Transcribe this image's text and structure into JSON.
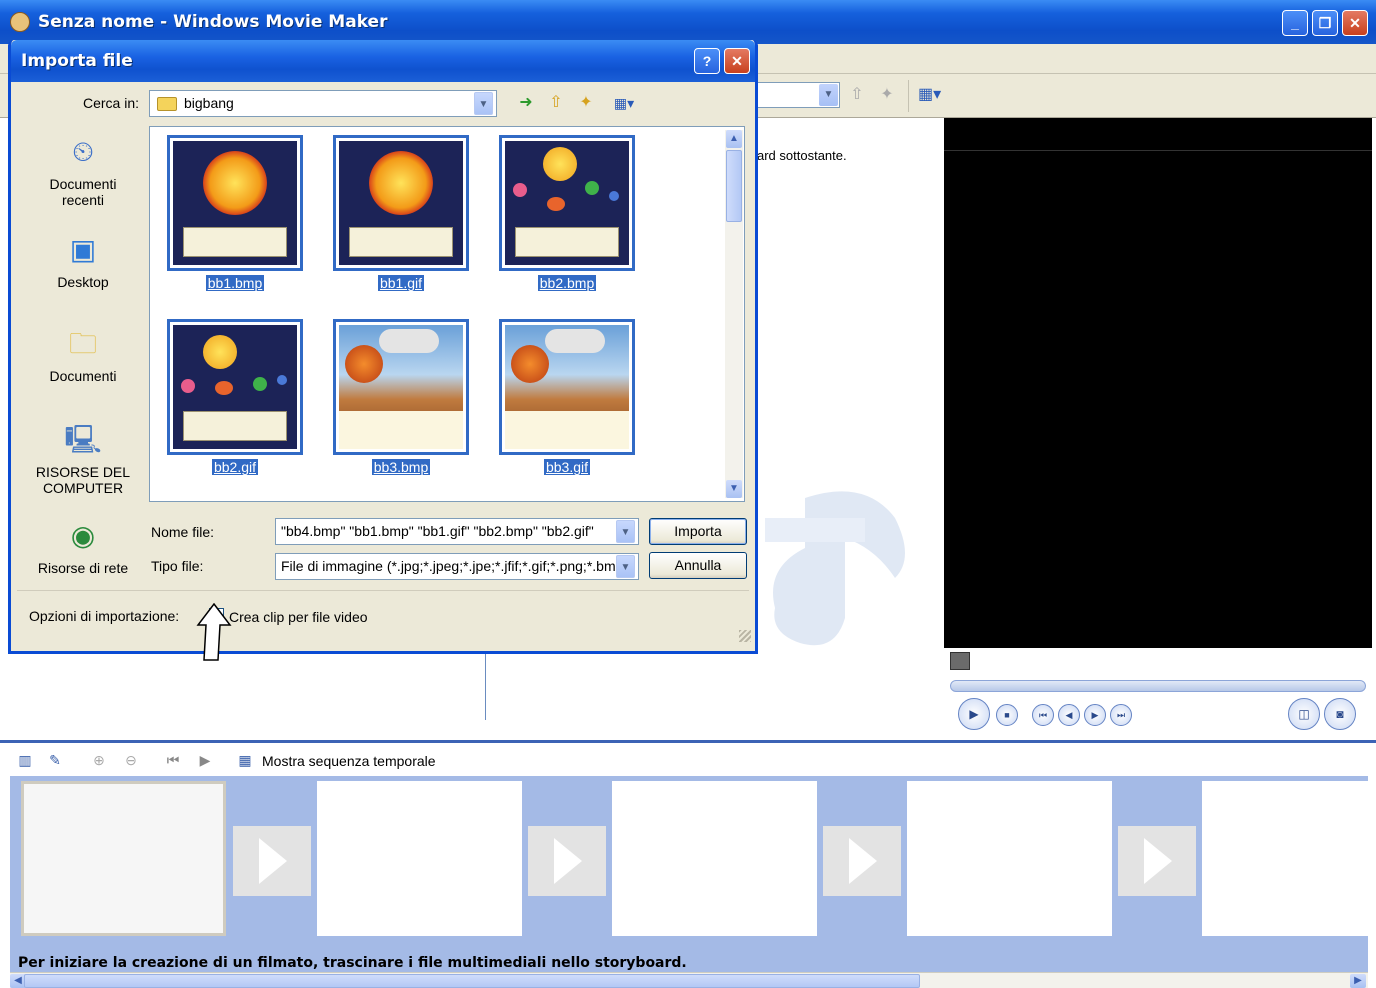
{
  "app": {
    "window_title": "Senza nome - Windows Movie Maker",
    "window_buttons": {
      "minimize": "_",
      "restore": "❐",
      "close": "✕"
    }
  },
  "collection": {
    "hint_fragment": "ard sottostante."
  },
  "dialog": {
    "title": "Importa file",
    "help_button": "?",
    "close_button": "✕",
    "look_in_label": "Cerca in:",
    "look_in_value": "bigbang",
    "places": [
      {
        "label": "Documenti recenti",
        "icon": "recent-documents-icon"
      },
      {
        "label": "Desktop",
        "icon": "desktop-icon"
      },
      {
        "label": "Documenti",
        "icon": "documents-icon"
      },
      {
        "label": "RISORSE DEL COMPUTER",
        "icon": "my-computer-icon"
      },
      {
        "label": "Risorse di rete",
        "icon": "network-icon"
      }
    ],
    "files": [
      {
        "name": "bb1.bmp",
        "kind": "sun"
      },
      {
        "name": "bb1.gif",
        "kind": "sun"
      },
      {
        "name": "bb2.bmp",
        "kind": "space"
      },
      {
        "name": "bb2.gif",
        "kind": "space"
      },
      {
        "name": "bb3.bmp",
        "kind": "quake"
      },
      {
        "name": "bb3.gif",
        "kind": "quake"
      }
    ],
    "filename_label": "Nome file:",
    "filename_value": "\"bb4.bmp\" \"bb1.bmp\" \"bb1.gif\" \"bb2.bmp\" \"bb2.gif\"",
    "filetype_label": "Tipo file:",
    "filetype_value": "File di immagine (*.jpg;*.jpeg;*.jpe;*.jfif;*.gif;*.png;*.bm",
    "import_button": "Importa",
    "cancel_button": "Annulla",
    "options_label": "Opzioni di importazione:",
    "create_clips_label": "Crea clip per file video",
    "create_clips_checked": true
  },
  "storyboard": {
    "show_timeline_label": "Mostra sequenza temporale",
    "message": "Per iniziare la creazione di un filmato, trascinare i file multimediali nello storyboard."
  },
  "colors": {
    "title_blue": "#0d4fc9",
    "selection_blue": "#316ac5",
    "storyboard_bg": "#a4bae6",
    "dialog_bg": "#ece9d8"
  }
}
